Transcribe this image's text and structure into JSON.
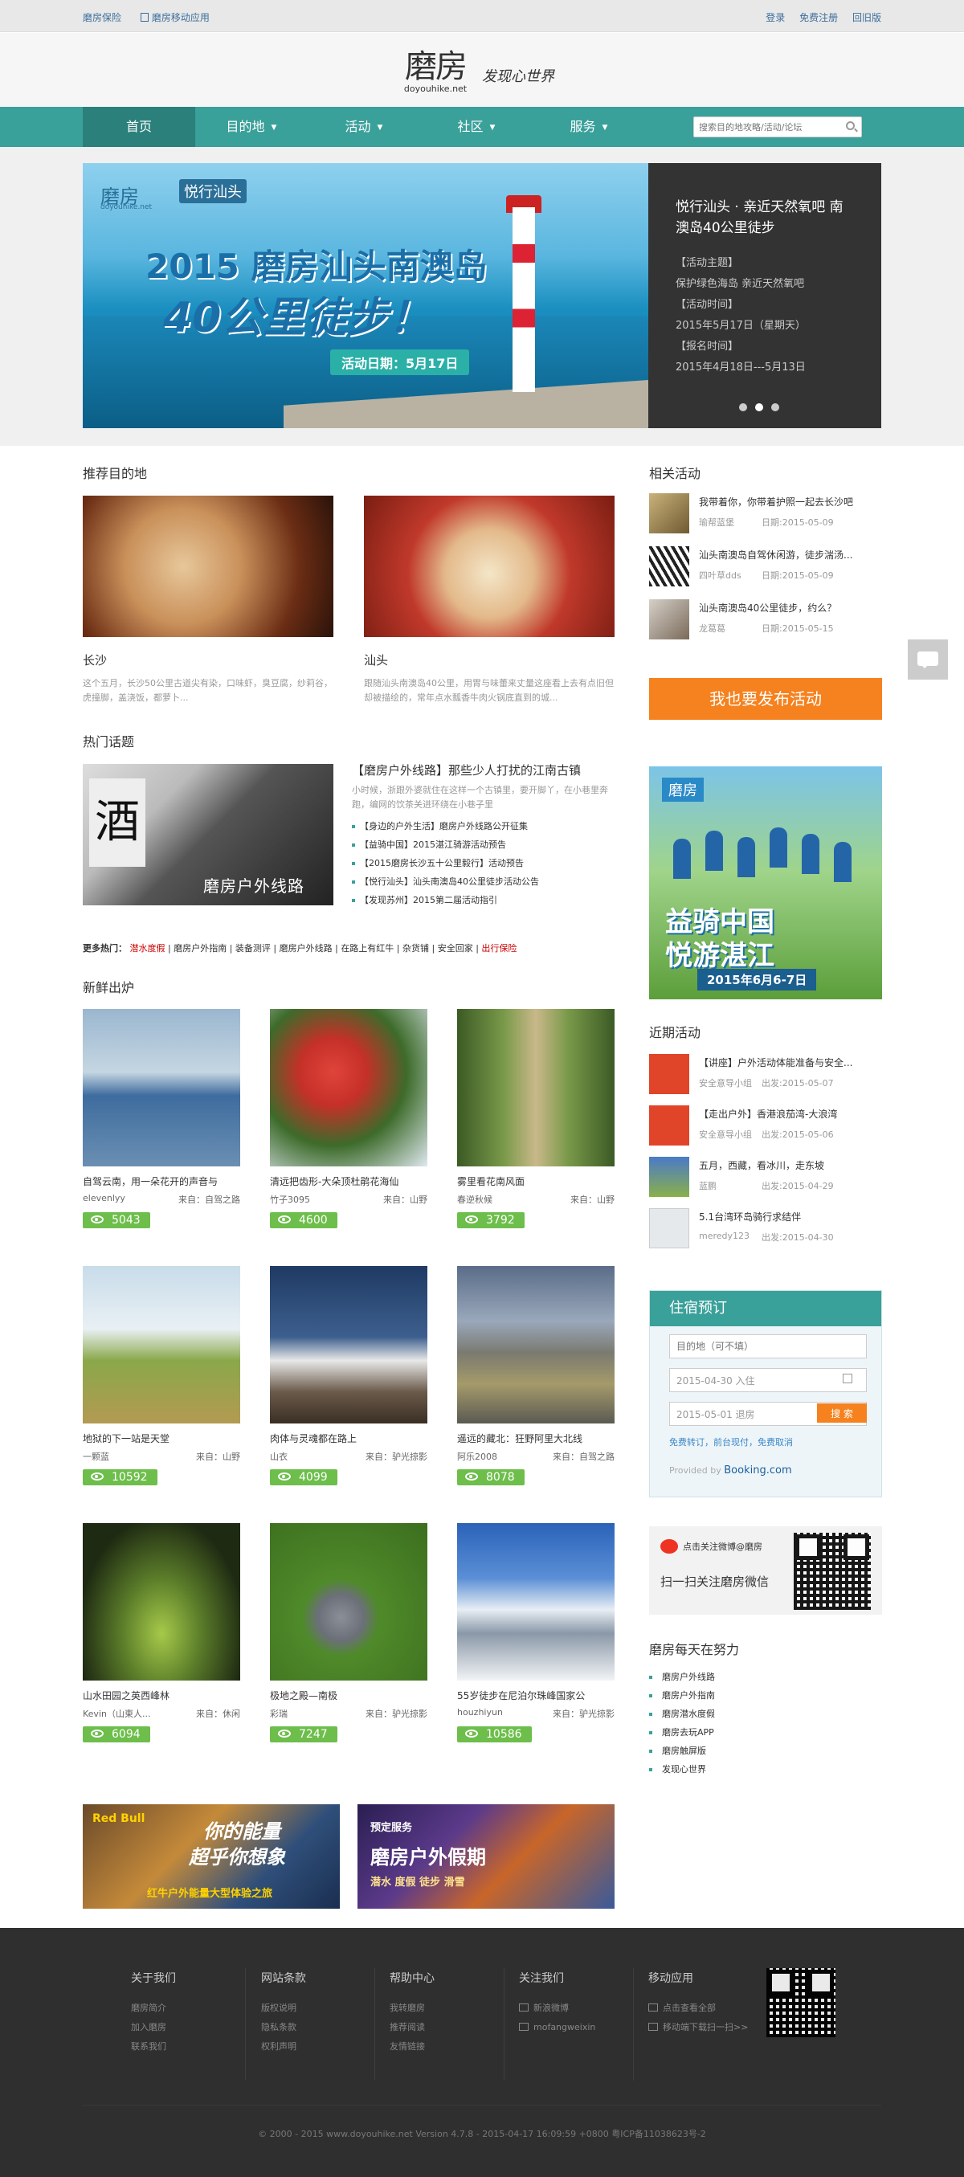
{
  "topbar": {
    "left": [
      "磨房保险",
      "磨房移动应用"
    ],
    "right": [
      "登录",
      "免费注册",
      "回旧版"
    ]
  },
  "header": {
    "logo_cn": "磨房",
    "logo_en": "doyouhike.net",
    "slogan": "发现心世界"
  },
  "nav": {
    "items": [
      "首页",
      "目的地",
      "活动",
      "社区",
      "服务"
    ],
    "search_placeholder": "搜索目的地攻略/活动/论坛"
  },
  "banner": {
    "logo1": "磨房",
    "logo1_en": "doyouhike.net",
    "logo2": "悦行汕头",
    "line1": "2015 磨房汕头南澳岛",
    "line2": "40公里徒步！",
    "date_badge": "活动日期：5月17日",
    "side_title": "悦行汕头 · 亲近天然氧吧 南澳岛40公里徒步",
    "side_lines": [
      "【活动主题】",
      "保护绿色海岛 亲近天然氧吧",
      "【活动时间】",
      "2015年5月17日（星期天）",
      "【报名时间】",
      "2015年4月18日---5月13日"
    ]
  },
  "recommend": {
    "heading": "推荐目的地",
    "items": [
      {
        "name": "长沙",
        "desc": "这个五月，长沙50公里古道尖有染，口味虾，臭豆腐，纱莉谷，虎撞脚，盖浇饭，都萝卜..."
      },
      {
        "name": "汕头",
        "desc": "跟随汕头南澳岛40公里，用胃与味蕾来丈量这座看上去有点旧但却被描绘的，常年点水瓢香牛肉火锅底直到的城..."
      }
    ]
  },
  "hot": {
    "heading": "热门话题",
    "img_caption": "磨房户外线路",
    "title": "【磨房户外线路】那些少人打扰的江南古镇",
    "summary": "小时候，浙跟外婆就住在这样一个古镇里，要开脚丫，在小巷里奔跑，编网的饮茶关进环绕在小巷子里",
    "items": [
      "【身边的户外生活】磨房户外线路公开征集",
      "【益骑中国】2015湛江骑游活动预告",
      "【2015磨房长沙五十公里毅行】活动预告",
      "【悦行汕头】汕头南澳岛40公里徒步活动公告",
      "【发现苏州】2015第二届活动指引"
    ],
    "more_label": "更多热门：",
    "more_links": [
      "潜水度假",
      "磨房户外指南",
      "装备测评",
      "磨房户外线路",
      "在路上有红牛",
      "杂货铺",
      "安全回家",
      "出行保险"
    ]
  },
  "fresh": {
    "heading": "新鲜出炉",
    "src_label": "来自：",
    "items": [
      {
        "title": "自驾云南，用一朵花开的声音与",
        "author": "elevenlyy",
        "source": "自驾之路",
        "views": "5043"
      },
      {
        "title": "清远把齿形-大朵顶杜鹃花海仙",
        "author": "竹子3095",
        "source": "山野",
        "views": "4600"
      },
      {
        "title": "雾里看花南风面",
        "author": "春逆秋候",
        "source": "山野",
        "views": "3792"
      },
      {
        "title": "地狱的下一站是天堂",
        "author": "一颗蓝",
        "source": "山野",
        "views": "10592"
      },
      {
        "title": "肉体与灵魂都在路上",
        "author": "山衣",
        "source": "驴光掠影",
        "views": "4099"
      },
      {
        "title": "遥远的藏北：狂野阿里大北线",
        "author": "阿乐2008",
        "source": "自驾之路",
        "views": "8078"
      },
      {
        "title": "山水田园之英西峰林",
        "author": "Kevin（山東人...",
        "source": "休闲",
        "views": "6094"
      },
      {
        "title": "极地之殿—南极",
        "author": "彩瑞",
        "source": "驴光掠影",
        "views": "7247"
      },
      {
        "title": "55岁徒步在尼泊尔珠峰国家公",
        "author": "houzhiyun",
        "source": "驴光掠影",
        "views": "10586"
      }
    ]
  },
  "ads": {
    "redbull_line1": "你的能量",
    "redbull_line2": "超乎你想象",
    "redbull_sub": "红牛户外能量大型体验之旅",
    "redbull_brand": "Red Bull",
    "vac_pre": "预定服务",
    "vac_title": "磨房户外假期",
    "vac_sub": "潜水 度假 徒步 滑雪"
  },
  "related": {
    "heading": "相关活动",
    "items": [
      {
        "title": "我带着你，你带着护照一起去长沙吧",
        "user": "瑜帮蓝堡",
        "date": "日期:2015-05-09"
      },
      {
        "title": "汕头南澳岛自驾休闲游，徒步湍汤...",
        "user": "四叶草dds",
        "date": "日期:2015-05-09"
      },
      {
        "title": "汕头南澳岛40公里徒步，约么？",
        "user": "龙葛葛",
        "date": "日期:2015-05-15"
      }
    ],
    "publish_button": "我也要发布活动"
  },
  "bikead": {
    "brand": "磨房",
    "line1": "益骑中国",
    "line2": "悦游湛江",
    "date": "2015年6月6-7日"
  },
  "recent": {
    "heading": "近期活动",
    "items": [
      {
        "title": "【讲座】户外活动体能准备与安全...",
        "user": "安全意导小组",
        "date": "出发:2015-05-07"
      },
      {
        "title": "【走出户外】香港浪茄湾-大浪湾",
        "user": "安全意导小组",
        "date": "出发:2015-05-06"
      },
      {
        "title": "五月，西藏，看冰川，走东坡",
        "user": "蓝鹏",
        "date": "出发:2015-04-29"
      },
      {
        "title": "5.1台湾环岛骑行求结伴",
        "user": "meredy123",
        "date": "出发:2015-04-30"
      }
    ]
  },
  "booking": {
    "heading": "住宿预订",
    "dest_placeholder": "目的地（可不填）",
    "checkin": "2015-04-30 入住",
    "checkout": "2015-05-01 退房",
    "links": "免费转订，前台现付，免费取消",
    "search_button": "搜 索",
    "provider": "Provided by",
    "provider_brand": "Booking.com"
  },
  "wechat": {
    "weibo": "点击关注微博@磨房",
    "scan": "扫一扫关注磨房微信"
  },
  "daily": {
    "heading": "磨房每天在努力",
    "items": [
      "磨房户外线路",
      "磨房户外指南",
      "磨房潜水度假",
      "磨房去玩APP",
      "磨房触屏版",
      "发现心世界"
    ]
  },
  "footer": {
    "cols": [
      {
        "head": "关于我们",
        "links": [
          "磨房简介",
          "加入磨房",
          "联系我们"
        ]
      },
      {
        "head": "网站条款",
        "links": [
          "版权说明",
          "隐私条款",
          "权利声明"
        ]
      },
      {
        "head": "帮助中心",
        "links": [
          "我转磨房",
          "推荐阅读",
          "友情链接"
        ]
      },
      {
        "head": "关注我们",
        "links": [
          "新浪微博",
          "mofangweixin"
        ]
      },
      {
        "head": "移动应用",
        "links": [
          "点击查看全部",
          "移动端下载扫一扫>>"
        ]
      }
    ],
    "copyright": "© 2000 - 2015 www.doyouhike.net Version 4.7.8 - 2015-04-17 16:09:59 +0800 粤ICP备11038623号-2"
  }
}
